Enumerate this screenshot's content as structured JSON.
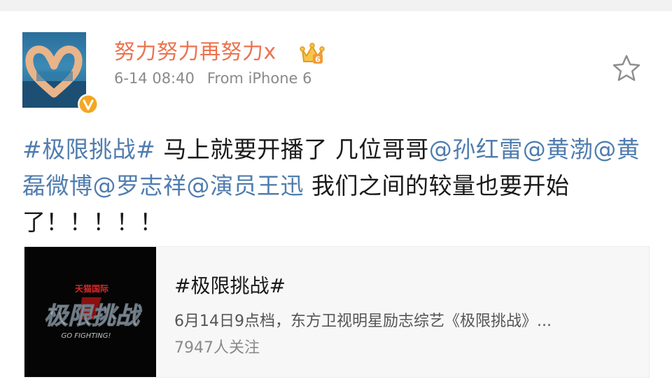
{
  "post": {
    "username": "努力努力再努力x",
    "time": "6-14 08:40",
    "source": "From iPhone 6",
    "icons": {
      "avatar": "heart-hands-avatar",
      "verified": "verified-v-icon",
      "member": "crown-icon",
      "favorite": "star-icon"
    },
    "content": {
      "topic": "#极限挑战#",
      "t1": " 马上就要开播了  几位哥哥",
      "mention1": "@孙红雷",
      "mention2": "@黄渤",
      "mention3": "@黄磊微博",
      "mention4": "@罗志祥",
      "mention5": "@演员王迅",
      "t2": " 我们之间的较量也要开始了！！！！！"
    }
  },
  "share_card": {
    "title": "#极限挑战#",
    "description": "6月14日9点档，东方卫视明星励志综艺《极限挑战》...",
    "followers": "7947人关注",
    "thumb_icon": "show-logo-thumbnail",
    "thumb_logo_text": "极限挑战",
    "thumb_sponsor_text": "天猫国际",
    "thumb_sub_text": "GO FIGHTING!"
  },
  "colors": {
    "username": "#eb7350",
    "link": "#507daf",
    "text": "#1a1a1a",
    "meta": "#8a8a8a"
  }
}
